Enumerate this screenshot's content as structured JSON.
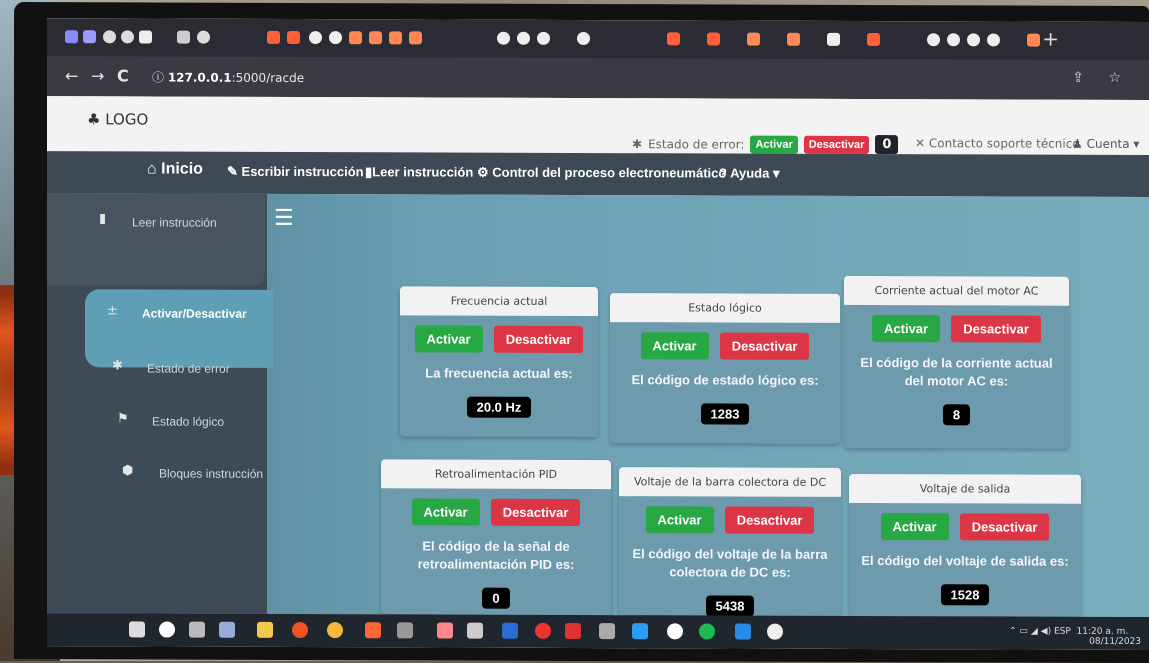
{
  "browser": {
    "url_host": "127.0.0.1",
    "url_path": ":5000/racde"
  },
  "header": {
    "logo": "LOGO",
    "error_label": "Estado de error:",
    "activate_label": "Activar",
    "deactivate_label": "Desactivar",
    "error_count": "0",
    "support_label": "Contacto soporte técnico",
    "account_label": "Cuenta"
  },
  "navbar": {
    "home": "Inicio",
    "write": "Escribir instrucción",
    "read": "Leer instrucción",
    "control": "Control del proceso electroneumático",
    "help": "Ayuda"
  },
  "sidebar": {
    "items": [
      {
        "label": "Leer instrucción",
        "icon": "file-icon"
      },
      {
        "label": "Activar/Desactivar",
        "icon": "plus-minus-icon"
      },
      {
        "label": "Estado de error",
        "icon": "bug-icon"
      },
      {
        "label": "Estado lógico",
        "icon": "flag-icon"
      },
      {
        "label": "Bloques instrucción",
        "icon": "cube-icon"
      }
    ]
  },
  "cards": [
    {
      "title": "Frecuencia actual",
      "text": "La frecuencia actual es:",
      "value": "20.0 Hz"
    },
    {
      "title": "Estado lógico",
      "text": "El código de estado lógico es:",
      "value": "1283"
    },
    {
      "title": "Corriente actual del motor AC",
      "text": "El código de la corriente actual del motor AC es:",
      "value": "8"
    },
    {
      "title": "Retroalimentación PID",
      "text": "El código de la señal de retroalimentación PID es:",
      "value": "0"
    },
    {
      "title": "Voltaje de la barra colectora de DC",
      "text": "El código del voltaje de la barra colectora de DC es:",
      "value": "5438"
    },
    {
      "title": "Voltaje de salida",
      "text": "El código del voltaje de salida es:",
      "value": "1528"
    }
  ],
  "buttons": {
    "activate": "Activar",
    "deactivate": "Desactivar"
  },
  "taskbar": {
    "lang": "ESP",
    "time": "11:20 a. m.",
    "date": "08/11/2023"
  },
  "colors": {
    "green": "#28a745",
    "red": "#dc3545",
    "navbar": "#3d4a56",
    "content": "#6d9bad"
  }
}
